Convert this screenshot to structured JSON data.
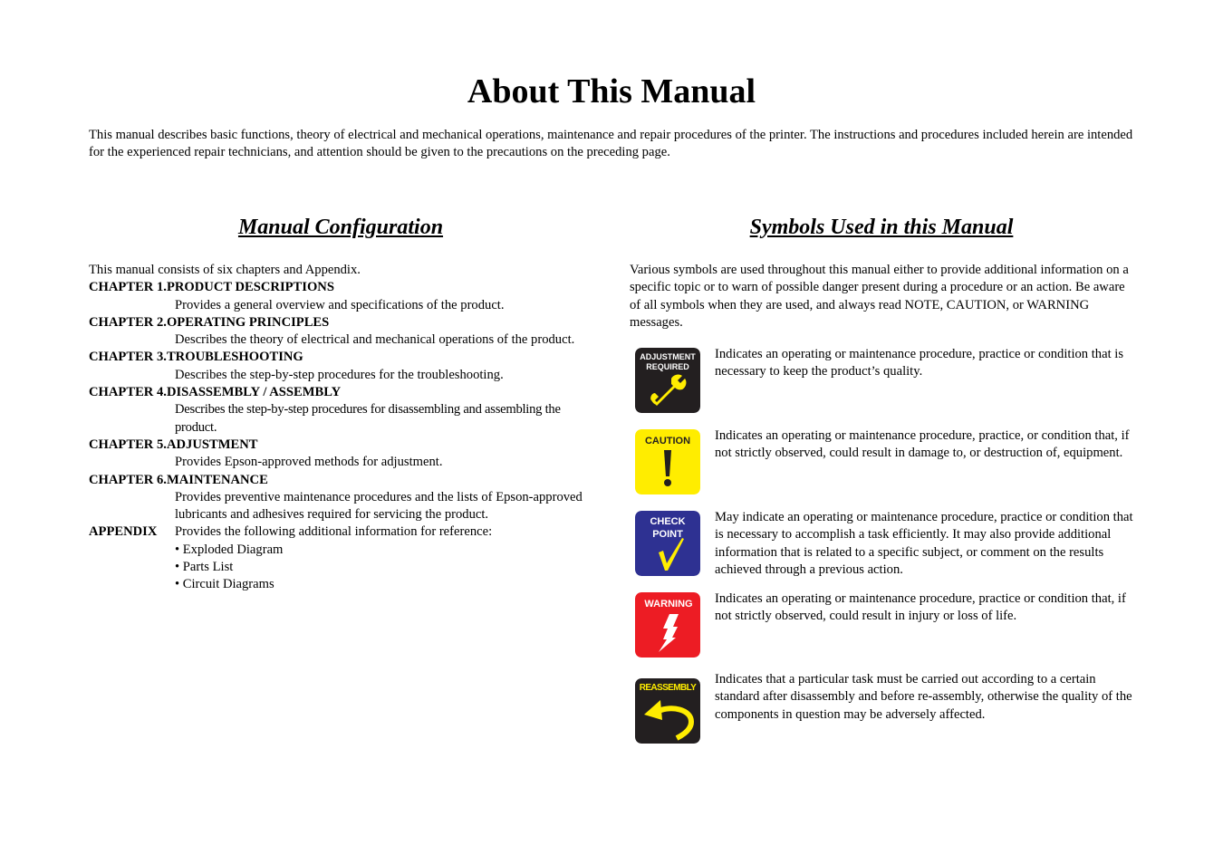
{
  "page": {
    "title": "About This Manual",
    "intro": "This manual describes basic functions, theory of electrical and mechanical operations, maintenance and repair procedures of the printer. The instructions and procedures included herein are intended for the experienced repair technicians, and attention should be given to the precautions on the preceding page."
  },
  "configuration": {
    "heading": "Manual Configuration",
    "lead": "This manual consists of six chapters and Appendix.",
    "chapters": [
      {
        "title": "CHAPTER 1.PRODUCT DESCRIPTIONS",
        "desc": "Provides a general overview and specifications of the product."
      },
      {
        "title": "CHAPTER 2.OPERATING PRINCIPLES",
        "desc": "Describes the theory of electrical and mechanical operations of the product."
      },
      {
        "title": "CHAPTER 3.TROUBLESHOOTING",
        "desc": "Describes the step-by-step procedures for the troubleshooting."
      },
      {
        "title": "CHAPTER 4.DISASSEMBLY / ASSEMBLY",
        "desc": "Describes the step-by-step procedures for disassembling and assembling the product."
      },
      {
        "title": "CHAPTER 5.ADJUSTMENT",
        "desc": "Provides Epson-approved methods for adjustment."
      },
      {
        "title": "CHAPTER 6.MAINTENANCE",
        "desc": "Provides preventive maintenance procedures and the lists of Epson-approved lubricants and adhesives required for servicing the product."
      }
    ],
    "appendix": {
      "label": "APPENDIX",
      "desc": "Provides the following additional information for reference:",
      "items": [
        "• Exploded Diagram",
        "• Parts List",
        "• Circuit Diagrams"
      ]
    }
  },
  "symbols": {
    "heading": "Symbols Used in this Manual",
    "lead": "Various symbols are used throughout this manual either to provide additional information on a specific topic or to warn of possible danger present during a procedure or an action. Be aware of all symbols when they are used, and always read NOTE, CAUTION, or WARNING messages.",
    "items": [
      {
        "icon": "adjustment-required-icon",
        "label_line1": "ADJUSTMENT",
        "label_line2": "REQUIRED",
        "bg_color": "#231f20",
        "fg_color": "#ffed00",
        "text": "Indicates an operating or maintenance procedure, practice or condition that is necessary to keep the product’s quality."
      },
      {
        "icon": "caution-icon",
        "label_line1": "CAUTION",
        "label_line2": "",
        "bg_color": "#ffed00",
        "fg_color": "#231f20",
        "text": "Indicates an operating or maintenance procedure, practice, or condition that, if not strictly observed, could result in damage to, or destruction of, equipment."
      },
      {
        "icon": "check-point-icon",
        "label_line1": "CHECK",
        "label_line2": "POINT",
        "bg_color": "#2e3192",
        "fg_color": "#ffed00",
        "text": "May indicate an operating or maintenance procedure, practice or condition that is necessary to accomplish a task efficiently. It may also provide additional information that is related to a specific subject, or comment on the results achieved through a previous action."
      },
      {
        "icon": "warning-icon",
        "label_line1": "WARNING",
        "label_line2": "",
        "bg_color": "#ed1c24",
        "fg_color": "#ffffff",
        "text": "Indicates an operating or maintenance procedure, practice or condition that, if not strictly observed, could result in injury or loss of life."
      },
      {
        "icon": "reassembly-icon",
        "label_line1": "REASSEMBLY",
        "label_line2": "",
        "bg_color": "#231f20",
        "fg_color": "#ffed00",
        "text": "Indicates that a particular task must be carried out according to a certain standard after disassembly and before re-assembly, otherwise the quality of the components in question may be adversely affected."
      }
    ]
  }
}
